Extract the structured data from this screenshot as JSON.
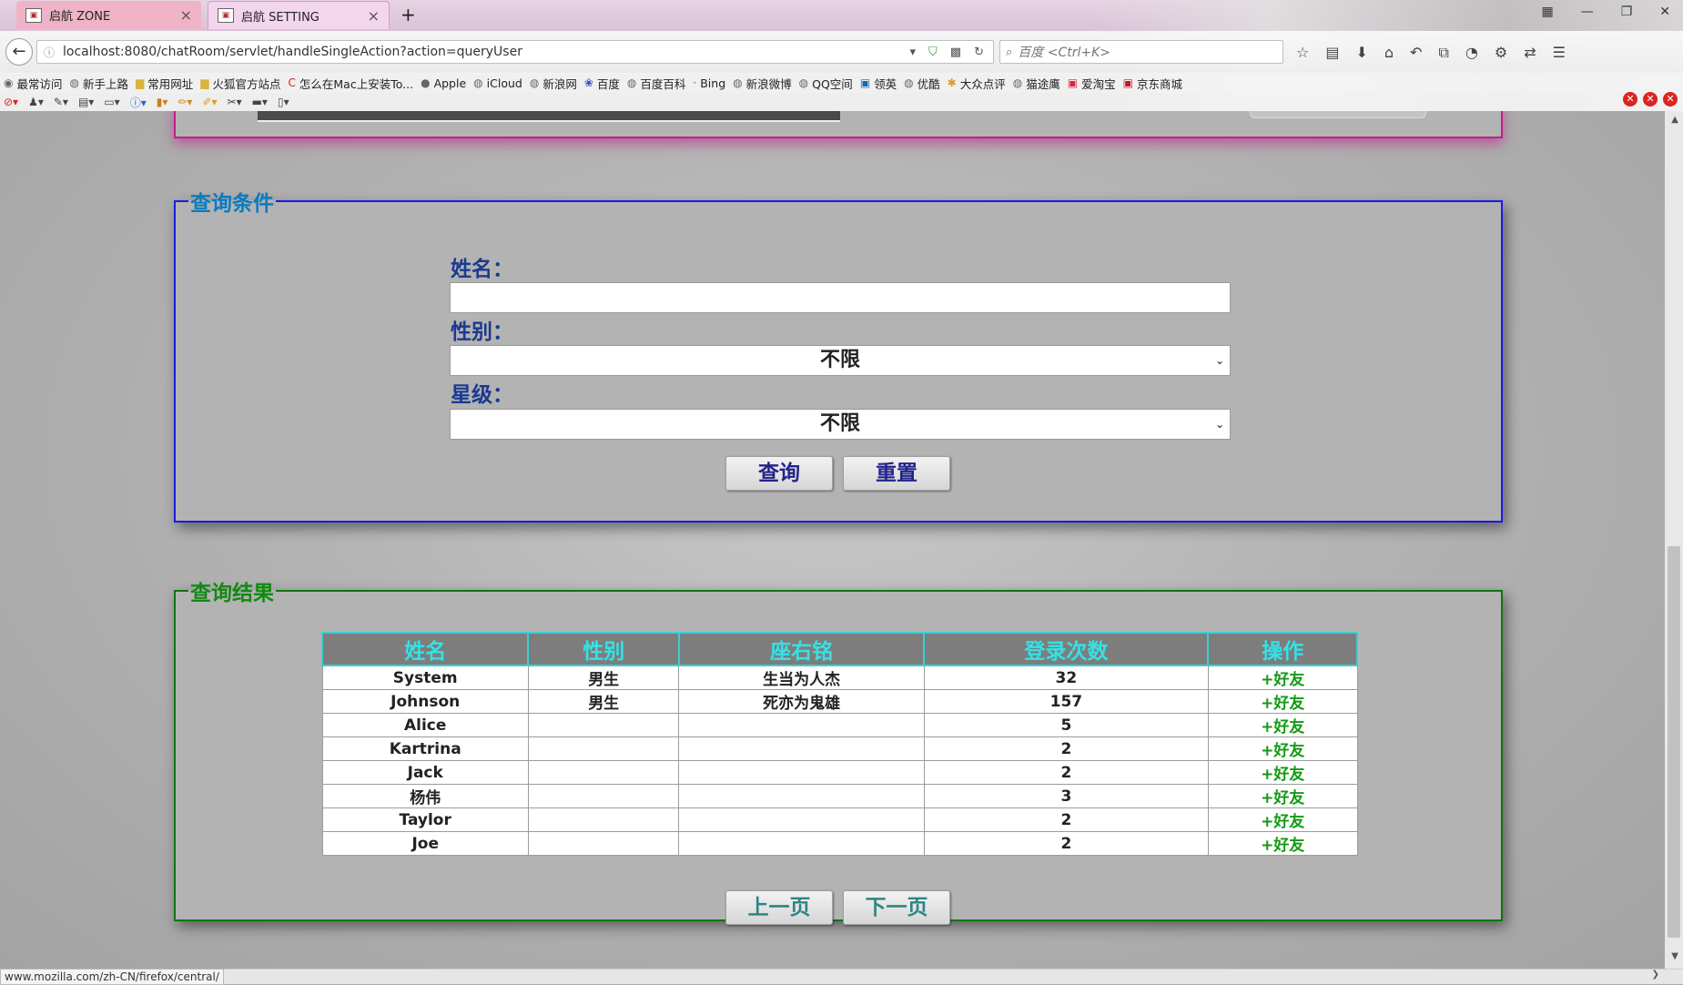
{
  "browser": {
    "tabs": [
      {
        "label": "启航 ZONE",
        "active": false
      },
      {
        "label": "启航 SETTING",
        "active": true
      }
    ],
    "url": "localhost:8080/chatRoom/servlet/handleSingleAction?action=queryUser",
    "search_placeholder": "百度 <Ctrl+K>",
    "bookmarks": [
      "最常访问",
      "新手上路",
      "常用网址",
      "火狐官方站点",
      "怎么在Mac上安装To...",
      "Apple",
      "iCloud",
      "新浪网",
      "百度",
      "百度百科",
      "Bing",
      "新浪微博",
      "QQ空间",
      "领英",
      "优酷",
      "大众点评",
      "猫途鹰",
      "爱淘宝",
      "京东商城"
    ],
    "status_url": "www.mozilla.com/zh-CN/firefox/central/"
  },
  "query_panel": {
    "legend": "查询条件",
    "name_label": "姓名：",
    "name_value": "",
    "gender_label": "性别：",
    "gender_value": "不限",
    "star_label": "星级：",
    "star_value": "不限",
    "query_button": "查询",
    "reset_button": "重置"
  },
  "result_panel": {
    "legend": "查询结果",
    "columns": [
      "姓名",
      "性别",
      "座右铭",
      "登录次数",
      "操作"
    ],
    "rows": [
      {
        "name": "System",
        "gender": "男生",
        "motto": "生当为人杰",
        "logins": "32",
        "action": "+好友"
      },
      {
        "name": "Johnson",
        "gender": "男生",
        "motto": "死亦为鬼雄",
        "logins": "157",
        "action": "+好友"
      },
      {
        "name": "Alice",
        "gender": "",
        "motto": "",
        "logins": "5",
        "action": "+好友"
      },
      {
        "name": "Kartrina",
        "gender": "",
        "motto": "",
        "logins": "2",
        "action": "+好友"
      },
      {
        "name": "Jack",
        "gender": "",
        "motto": "",
        "logins": "2",
        "action": "+好友"
      },
      {
        "name": "杨伟",
        "gender": "",
        "motto": "",
        "logins": "3",
        "action": "+好友"
      },
      {
        "name": "Taylor",
        "gender": "",
        "motto": "",
        "logins": "2",
        "action": "+好友"
      },
      {
        "name": "Joe",
        "gender": "",
        "motto": "",
        "logins": "2",
        "action": "+好友"
      }
    ],
    "prev_button": "上一页",
    "next_button": "下一页"
  },
  "colors": {
    "query_border": "#1a1ae6",
    "result_border": "#107510",
    "top_panel_glow": "#c0208c",
    "header_bg": "#7d7d7d",
    "header_text": "#34e2e6",
    "action_text": "#159a15"
  }
}
